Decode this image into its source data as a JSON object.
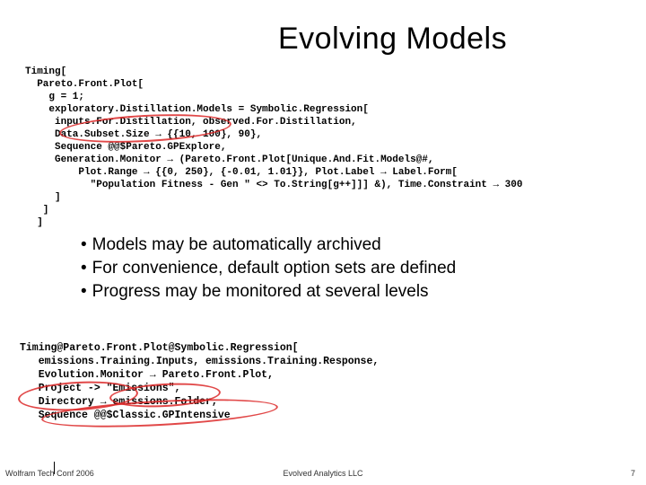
{
  "title": "Evolving Models",
  "code1": "Timing[\n  Pareto.Front.Plot[\n    g = 1;\n    exploratory.Distillation.Models = Symbolic.Regression[\n     inputs.For.Distillation, observed.For.Distillation,\n     Data.Subset.Size → {{10, 100}, 90},\n     Sequence @@$Pareto.GPExplore,\n     Generation.Monitor → (Pareto.Front.Plot[Unique.And.Fit.Models@#,\n         Plot.Range → {{0, 250}, {-0.01, 1.01}}, Plot.Label → Label.Form[\n           \"Population Fitness - Gen \" <> To.String[g++]]] &), Time.Constraint → 300\n     ]\n   ]\n  ]",
  "bullets": [
    "Models may be automatically archived",
    "For convenience, default option sets are defined",
    "Progress may be monitored at several levels"
  ],
  "code2": "Timing@Pareto.Front.Plot@Symbolic.Regression[\n   emissions.Training.Inputs, emissions.Training.Response,\n   Evolution.Monitor → Pareto.Front.Plot,\n   Project -> \"Emissions\",\n   Directory → emissions.Folder,\n   Sequence @@$Classic.GPIntensive",
  "footer": {
    "left": "Wolfram Tech Conf 2006",
    "center": "Evolved Analytics LLC",
    "right": "7"
  }
}
